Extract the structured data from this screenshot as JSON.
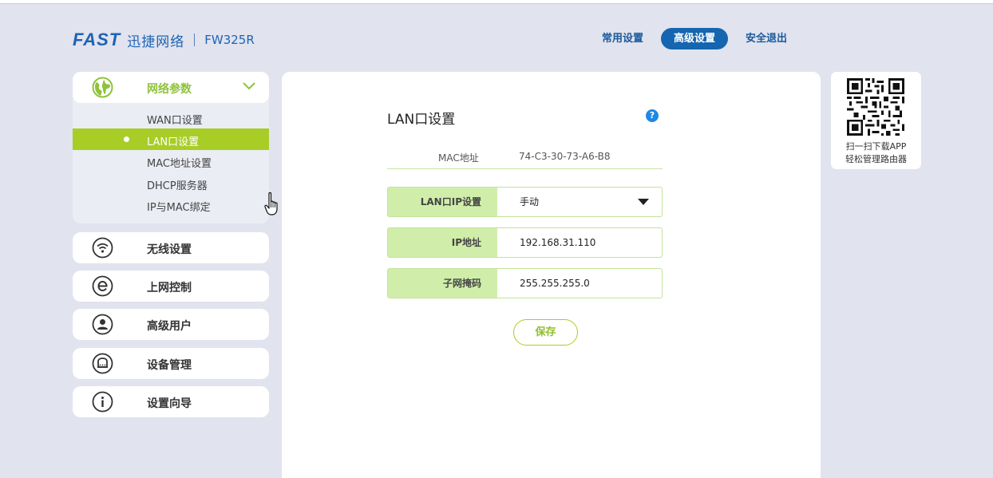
{
  "header": {
    "logo_brand": "FAST",
    "logo_cn": "迅捷网络",
    "model": "FW325R",
    "nav": [
      {
        "label": "常用设置",
        "active": false
      },
      {
        "label": "高级设置",
        "active": true
      },
      {
        "label": "安全退出",
        "active": false
      }
    ]
  },
  "sidebar": {
    "open_group": {
      "label": "网络参数",
      "icon": "globe-icon",
      "items": [
        {
          "label": "WAN口设置",
          "active": false
        },
        {
          "label": "LAN口设置",
          "active": true
        },
        {
          "label": "MAC地址设置",
          "active": false
        },
        {
          "label": "DHCP服务器",
          "active": false
        },
        {
          "label": "IP与MAC绑定",
          "active": false
        }
      ]
    },
    "groups": [
      {
        "label": "无线设置",
        "icon": "wifi-icon"
      },
      {
        "label": "上网控制",
        "icon": "internet-e-icon"
      },
      {
        "label": "高级用户",
        "icon": "user-icon"
      },
      {
        "label": "设备管理",
        "icon": "router-icon"
      },
      {
        "label": "设置向导",
        "icon": "info-icon"
      }
    ]
  },
  "main": {
    "title": "LAN口设置",
    "help": "?",
    "mac": {
      "label": "MAC地址",
      "value": "74-C3-30-73-A6-B8"
    },
    "fields": [
      {
        "label": "LAN口IP设置",
        "value": "手动",
        "type": "select"
      },
      {
        "label": "IP地址",
        "value": "192.168.31.110",
        "type": "input"
      },
      {
        "label": "子网掩码",
        "value": "255.255.255.0",
        "type": "input"
      }
    ],
    "save_label": "保存"
  },
  "qr": {
    "line1": "扫一扫下载APP",
    "line2": "轻松管理路由器"
  },
  "colors": {
    "accent_green": "#a8cd27",
    "brand_blue": "#1565b0",
    "background": "#e1e3ee"
  }
}
